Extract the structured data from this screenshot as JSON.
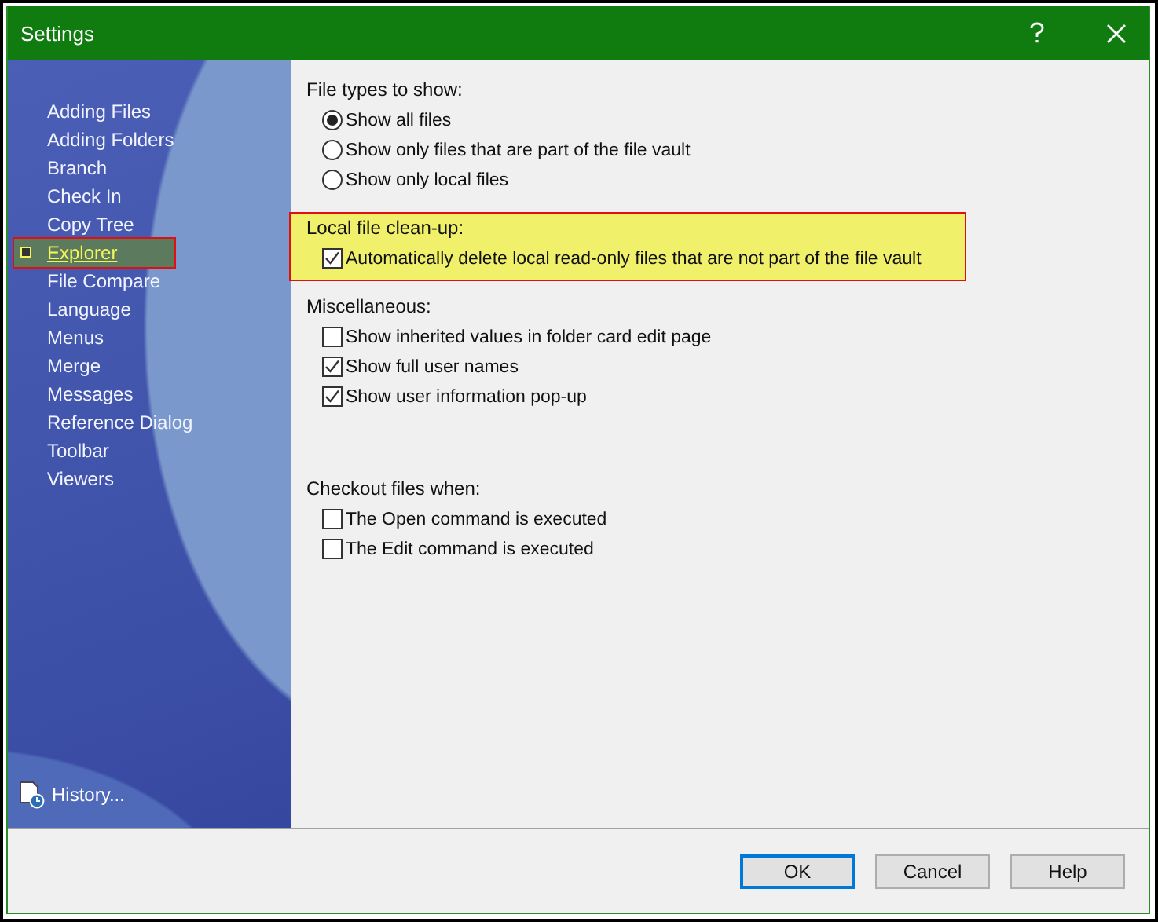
{
  "window": {
    "title": "Settings"
  },
  "sidebar": {
    "items": [
      {
        "label": "Adding Files",
        "selected": false,
        "marked": false
      },
      {
        "label": "Adding Folders",
        "selected": false,
        "marked": false
      },
      {
        "label": "Branch",
        "selected": false,
        "marked": false
      },
      {
        "label": "Check In",
        "selected": false,
        "marked": false
      },
      {
        "label": "Copy Tree",
        "selected": false,
        "marked": false
      },
      {
        "label": "Explorer",
        "selected": true,
        "marked": true
      },
      {
        "label": "File Compare",
        "selected": false,
        "marked": false
      },
      {
        "label": "Language",
        "selected": false,
        "marked": false
      },
      {
        "label": "Menus",
        "selected": false,
        "marked": false
      },
      {
        "label": "Merge",
        "selected": false,
        "marked": false
      },
      {
        "label": "Messages",
        "selected": false,
        "marked": false
      },
      {
        "label": "Reference Dialog",
        "selected": false,
        "marked": false
      },
      {
        "label": "Toolbar",
        "selected": false,
        "marked": false
      },
      {
        "label": "Viewers",
        "selected": false,
        "marked": false
      }
    ],
    "history": "History..."
  },
  "groups": [
    {
      "title": "File types to show:",
      "highlighted": false,
      "options": [
        {
          "kind": "radio",
          "label": "Show all files",
          "selected": true
        },
        {
          "kind": "radio",
          "label": "Show only files that are part of the file vault",
          "selected": false
        },
        {
          "kind": "radio",
          "label": "Show only local files",
          "selected": false
        }
      ]
    },
    {
      "title": "Local file clean-up:",
      "highlighted": true,
      "options": [
        {
          "kind": "checkbox",
          "label": "Automatically delete local read-only files that are not part of the file vault",
          "checked": true
        }
      ]
    },
    {
      "title": "Miscellaneous:",
      "highlighted": false,
      "options": [
        {
          "kind": "checkbox",
          "label": "Show inherited values in folder card edit page",
          "checked": false
        },
        {
          "kind": "checkbox",
          "label": "Show full user names",
          "checked": true
        },
        {
          "kind": "checkbox",
          "label": "Show user information pop-up",
          "checked": true
        }
      ]
    },
    {
      "title": "Checkout files when:",
      "highlighted": false,
      "options": [
        {
          "kind": "checkbox",
          "label": "The Open command is executed",
          "checked": false
        },
        {
          "kind": "checkbox",
          "label": "The Edit command is executed",
          "checked": false
        }
      ]
    }
  ],
  "buttons": [
    {
      "label": "OK",
      "default": true
    },
    {
      "label": "Cancel",
      "default": false
    },
    {
      "label": "Help",
      "default": false
    }
  ]
}
